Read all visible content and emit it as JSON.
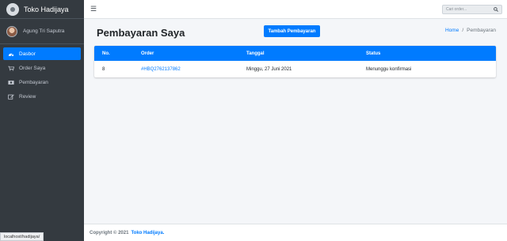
{
  "brand": {
    "name": "Toko Hadijaya"
  },
  "user": {
    "name": "Agung Tri Saputra"
  },
  "sidebar": {
    "items": [
      {
        "label": "Dasbor",
        "icon": "dashboard-icon",
        "active": true
      },
      {
        "label": "Order Saya",
        "icon": "cart-icon",
        "active": false
      },
      {
        "label": "Pembayaran",
        "icon": "payment-icon",
        "active": false
      },
      {
        "label": "Review",
        "icon": "edit-icon",
        "active": false
      }
    ]
  },
  "topbar": {
    "menu_icon": "☰",
    "search": {
      "placeholder": "Cari order..."
    }
  },
  "page": {
    "title": "Pembayaran Saya",
    "add_button": "Tambah Pembayaran",
    "breadcrumb": {
      "home": "Home",
      "separator": "/",
      "current": "Pembayaran"
    }
  },
  "table": {
    "headers": [
      "No.",
      "Order",
      "Tanggal",
      "Status"
    ],
    "rows": [
      {
        "no": "8",
        "order": "#HBQ2762137862",
        "date": "Minggu, 27 Juni 2021",
        "status": "Menunggu konfirmasi"
      }
    ]
  },
  "footer": {
    "prefix": "Copyright © 2021",
    "brand": "Toko Hadijaya."
  },
  "status_url": "localhost/hadijaya/",
  "colors": {
    "accent": "#007bff",
    "sidebar": "#343a40"
  }
}
